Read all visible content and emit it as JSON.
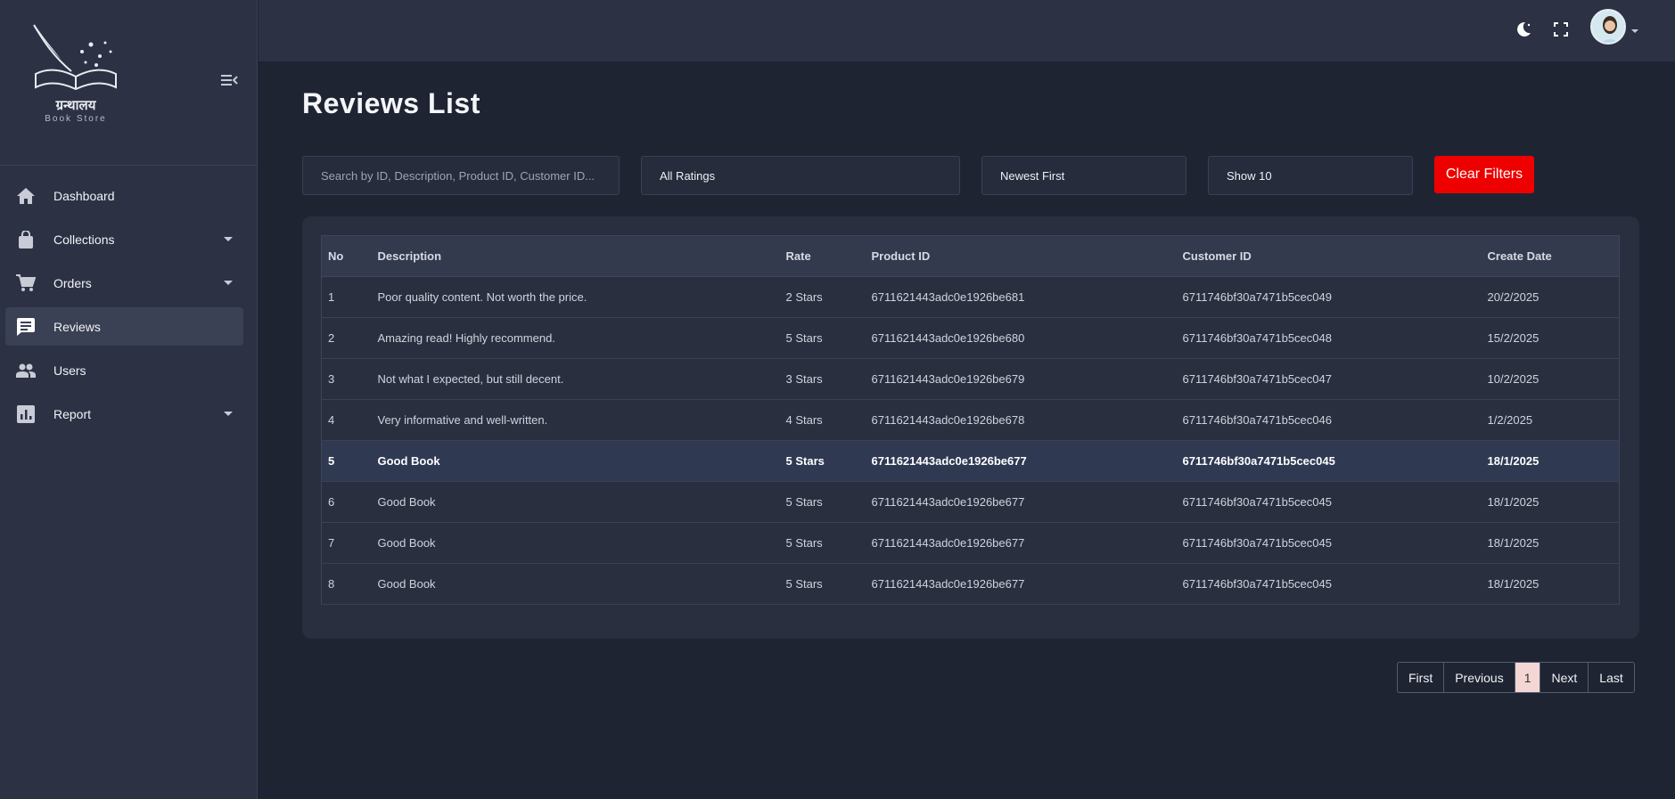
{
  "brand": {
    "name_hindi": "ग्रन्थालय",
    "subtitle": "Book Store"
  },
  "sidebar": {
    "items": [
      {
        "label": "Dashboard",
        "icon": "home-icon",
        "has_caret": false,
        "active": false
      },
      {
        "label": "Collections",
        "icon": "shopping-bag-icon",
        "has_caret": true,
        "active": false
      },
      {
        "label": "Orders",
        "icon": "cart-icon",
        "has_caret": true,
        "active": false
      },
      {
        "label": "Reviews",
        "icon": "comment-icon",
        "has_caret": false,
        "active": true
      },
      {
        "label": "Users",
        "icon": "users-icon",
        "has_caret": false,
        "active": false
      },
      {
        "label": "Report",
        "icon": "chart-icon",
        "has_caret": true,
        "active": false
      }
    ]
  },
  "header": {
    "icons": [
      "theme-moon-icon",
      "fullscreen-icon",
      "avatar"
    ]
  },
  "page": {
    "title": "Reviews List"
  },
  "filters": {
    "search_placeholder": "Search by ID, Description, Product ID, Customer ID...",
    "rating": "All Ratings",
    "sort": "Newest First",
    "page_size": "Show 10",
    "clear_label": "Clear Filters"
  },
  "table": {
    "columns": [
      "No",
      "Description",
      "Rate",
      "Product ID",
      "Customer ID",
      "Create Date"
    ],
    "rows": [
      [
        "1",
        "Poor quality content. Not worth the price.",
        "2 Stars",
        "6711621443adc0e1926be681",
        "6711746bf30a7471b5cec049",
        "20/2/2025"
      ],
      [
        "2",
        "Amazing read! Highly recommend.",
        "5 Stars",
        "6711621443adc0e1926be680",
        "6711746bf30a7471b5cec048",
        "15/2/2025"
      ],
      [
        "3",
        "Not what I expected, but still decent.",
        "3 Stars",
        "6711621443adc0e1926be679",
        "6711746bf30a7471b5cec047",
        "10/2/2025"
      ],
      [
        "4",
        "Very informative and well-written.",
        "4 Stars",
        "6711621443adc0e1926be678",
        "6711746bf30a7471b5cec046",
        "1/2/2025"
      ],
      [
        "5",
        "Good Book",
        "5 Stars",
        "6711621443adc0e1926be677",
        "6711746bf30a7471b5cec045",
        "18/1/2025"
      ],
      [
        "6",
        "Good Book",
        "5 Stars",
        "6711621443adc0e1926be677",
        "6711746bf30a7471b5cec045",
        "18/1/2025"
      ],
      [
        "7",
        "Good Book",
        "5 Stars",
        "6711621443adc0e1926be677",
        "6711746bf30a7471b5cec045",
        "18/1/2025"
      ],
      [
        "8",
        "Good Book",
        "5 Stars",
        "6711621443adc0e1926be677",
        "6711746bf30a7471b5cec045",
        "18/1/2025"
      ]
    ],
    "highlighted_row": 4
  },
  "pagination": {
    "first": "First",
    "previous": "Previous",
    "current": "1",
    "next": "Next",
    "last": "Last"
  },
  "colors": {
    "accent_red": "#ee0000",
    "bg": "#1f2433",
    "panel": "#2c3244"
  }
}
